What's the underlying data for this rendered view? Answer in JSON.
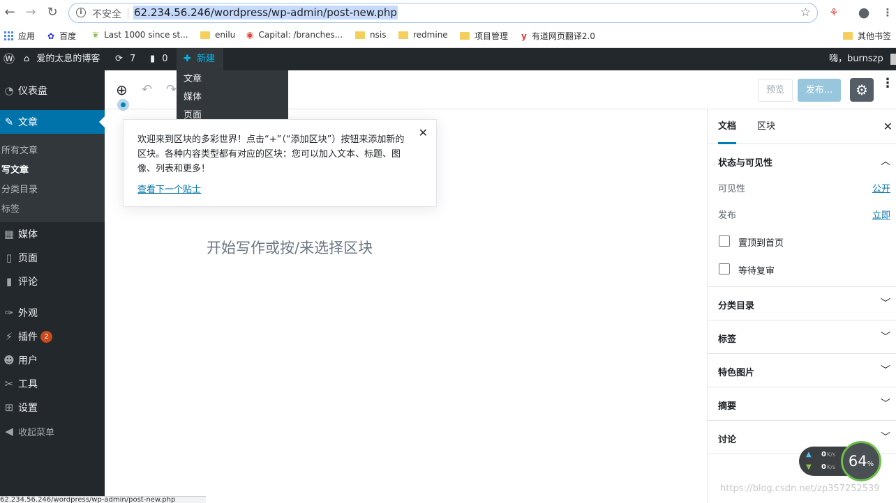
{
  "browser": {
    "insecure_label": "不安全",
    "url": "62.234.56.246/wordpress/wp-admin/post-new.php",
    "bookmarks": [
      {
        "label": "应用"
      },
      {
        "label": "百度"
      },
      {
        "label": "Last 1000 since st..."
      },
      {
        "label": "enilu"
      },
      {
        "label": "Capital: /branches..."
      },
      {
        "label": "nsis"
      },
      {
        "label": "redmine"
      },
      {
        "label": "项目管理"
      },
      {
        "label": "有道网页翻译2.0"
      },
      {
        "label": "其他书签"
      }
    ],
    "status_url": "62.234.56.246/wordpress/wp-admin/post-new.php"
  },
  "adminbar": {
    "site_name": "爱的太息的博客",
    "updates_count": "7",
    "comments_count": "0",
    "new_label": "新建",
    "greeting": "嗨，burnszp",
    "new_menu": [
      "文章",
      "媒体",
      "页面"
    ]
  },
  "sidebar": {
    "dashboard": "仪表盘",
    "posts": "文章",
    "posts_sub": [
      "所有文章",
      "写文章",
      "分类目录",
      "标签"
    ],
    "media": "媒体",
    "pages": "页面",
    "comments": "评论",
    "appearance": "外观",
    "plugins": "插件",
    "plugins_badge": "2",
    "users": "用户",
    "tools": "工具",
    "settings": "设置",
    "collapse": "收起菜单"
  },
  "editor": {
    "preview_label": "预览",
    "publish_label": "发布...",
    "placeholder": "开始写作或按/来选择区块",
    "tip_text": "欢迎来到区块的多彩世界！点击“+”（“添加区块”）按钮来添加新的区块。各种内容类型都有对应的区块：您可以加入文本、标题、图像、列表和更多！",
    "tip_link": "查看下一个贴士"
  },
  "settings_panel": {
    "tab_document": "文档",
    "tab_block": "区块",
    "status_title": "状态与可见性",
    "visibility_label": "可见性",
    "visibility_value": "公开",
    "publish_label": "发布",
    "publish_value": "立即",
    "stick_label": "置顶到首页",
    "pending_label": "等待复审",
    "panels": [
      "分类目录",
      "标签",
      "特色图片",
      "摘要",
      "讨论"
    ]
  },
  "speed_widget": {
    "up": "0",
    "down": "0",
    "unit": "K/s",
    "percent": "64",
    "percent_sign": "%"
  },
  "watermark": "https://blog.csdn.net/zp357252539"
}
